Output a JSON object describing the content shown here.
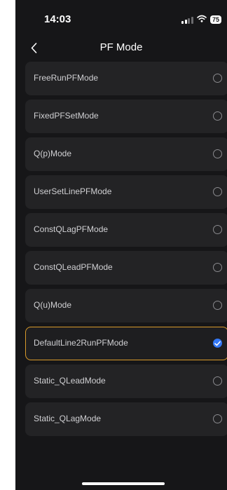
{
  "status_bar": {
    "time": "14:03",
    "battery": "75",
    "icons": [
      "signal-icon",
      "wifi-icon",
      "battery-icon"
    ]
  },
  "nav": {
    "back_icon": "chevron-left-icon",
    "title": "PF Mode"
  },
  "options": [
    {
      "label": "FreeRunPFMode",
      "selected": false
    },
    {
      "label": "FixedPFSetMode",
      "selected": false
    },
    {
      "label": "Q(p)Mode",
      "selected": false
    },
    {
      "label": "UserSetLinePFMode",
      "selected": false
    },
    {
      "label": "ConstQLagPFMode",
      "selected": false
    },
    {
      "label": "ConstQLeadPFMode",
      "selected": false
    },
    {
      "label": "Q(u)Mode",
      "selected": false
    },
    {
      "label": "DefaultLine2RunPFMode",
      "selected": true
    },
    {
      "label": "Static_QLeadMode",
      "selected": false
    },
    {
      "label": "Static_QLagMode",
      "selected": false
    }
  ],
  "colors": {
    "background": "#161618",
    "row": "#232325",
    "selected_border": "#d99a2b",
    "check": "#3478f6"
  }
}
